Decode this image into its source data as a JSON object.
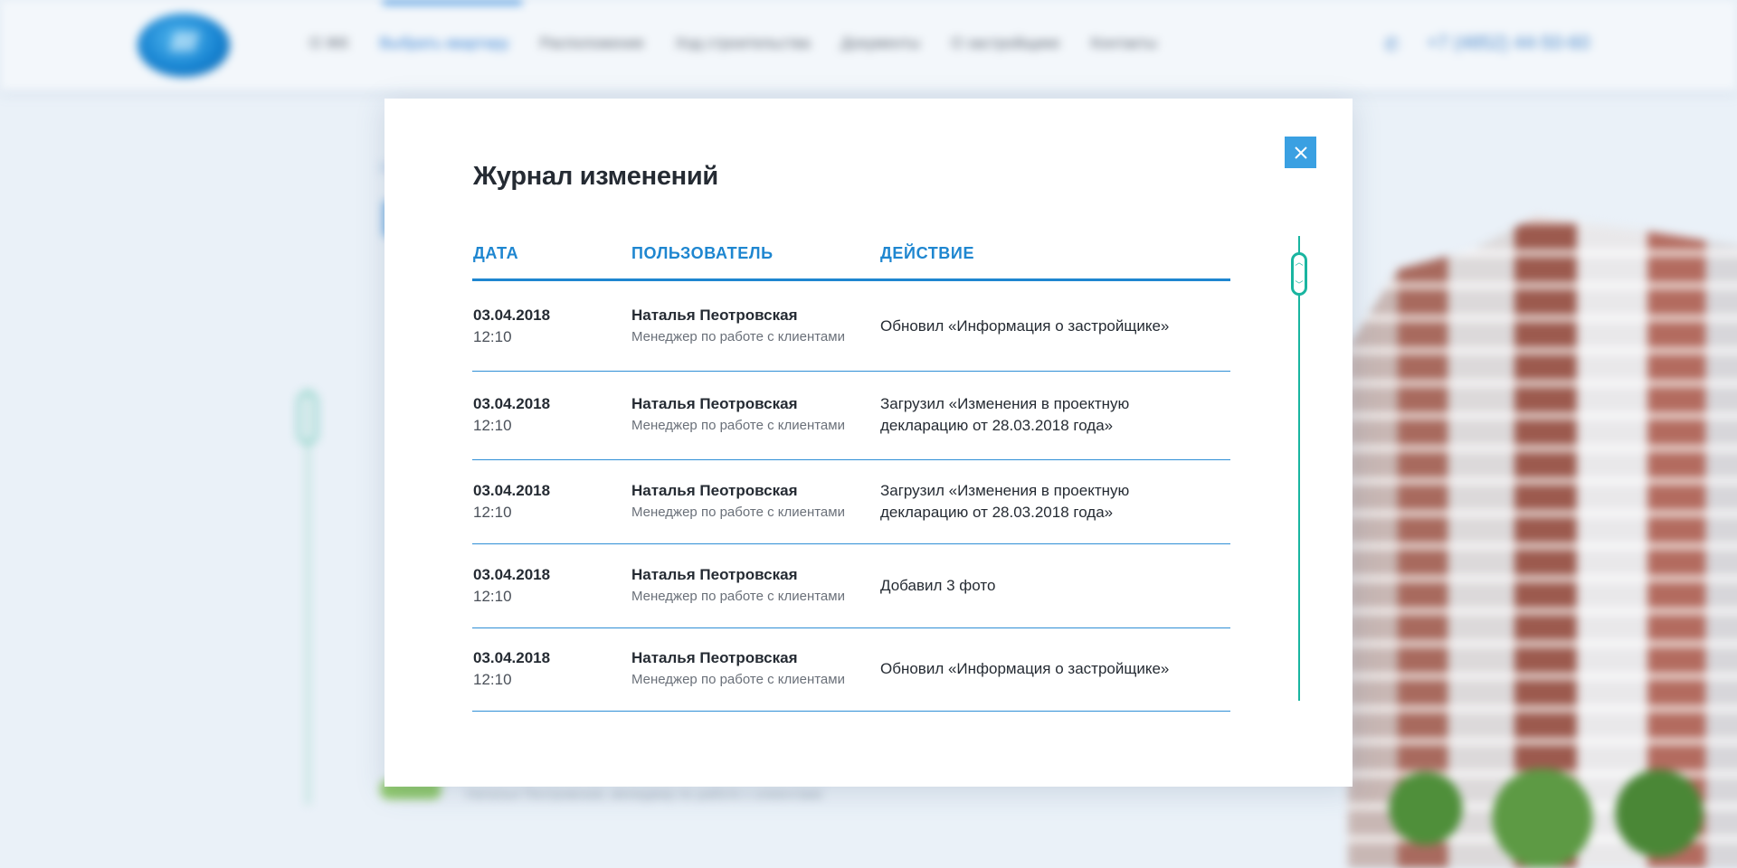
{
  "background": {
    "nav": [
      "О ЖК",
      "Выбрать квартиру",
      "Расположение",
      "Ход строительства",
      "Документы",
      "О застройщике",
      "Контакты"
    ],
    "phone": "+7 (4852) 44-50-60",
    "footer_text": "Наталья Пеотровская, менеджер по работе с клиентами"
  },
  "modal": {
    "title": "Журнал изменений",
    "close_icon": "close-icon",
    "columns": [
      "Дата",
      "Пользователь",
      "Действие"
    ],
    "rows": [
      {
        "date": "03.04.2018",
        "time": "12:10",
        "user": "Наталья Пеотровская",
        "role": "Менеджер по работе с клиентами",
        "action": "Обновил  «Информация о застройщике»"
      },
      {
        "date": "03.04.2018",
        "time": "12:10",
        "user": "Наталья Пеотровская",
        "role": "Менеджер по работе с клиентами",
        "action": "Загрузил «Изменения в проектную декларацию от 28.03.2018 года»"
      },
      {
        "date": "03.04.2018",
        "time": "12:10",
        "user": "Наталья Пеотровская",
        "role": "Менеджер по работе с клиентами",
        "action": "Загрузил «Изменения в проектную декларацию от 28.03.2018 года»"
      },
      {
        "date": "03.04.2018",
        "time": "12:10",
        "user": "Наталья Пеотровская",
        "role": "Менеджер по работе с клиентами",
        "action": "Добавил 3 фото"
      },
      {
        "date": "03.04.2018",
        "time": "12:10",
        "user": "Наталья Пеотровская",
        "role": "Менеджер по работе с клиентами",
        "action": "Обновил  «Информация о застройщике»"
      }
    ]
  },
  "colors": {
    "accent": "#1e86d0",
    "close_button": "#3aa0e2",
    "scrollbar": "#19b5a0",
    "text": "#252b33"
  }
}
